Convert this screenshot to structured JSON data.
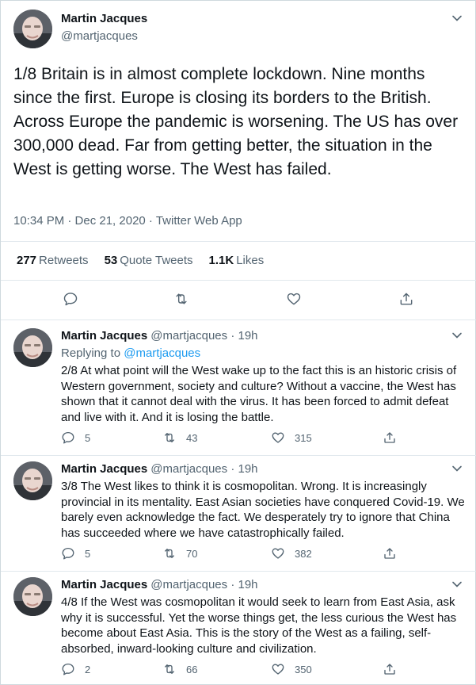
{
  "main": {
    "name": "Martin Jacques",
    "handle": "@martjacques",
    "text": "1/8 Britain is in almost complete lockdown. Nine months since the first. Europe is closing its borders to the British. Across Europe the pandemic is worsening. The US has over 300,000 dead. Far from getting better, the situation in the West is getting worse. The West has failed.",
    "meta": "10:34 PM · Dec 21, 2020 · Twitter Web App",
    "stats": {
      "retweets_count": "277",
      "retweets_label": "Retweets",
      "quotes_count": "53",
      "quotes_label": "Quote Tweets",
      "likes_count": "1.1K",
      "likes_label": "Likes"
    }
  },
  "replies": [
    {
      "name": "Martin Jacques",
      "handle": "@martjacques · 19h",
      "replying_prefix": "Replying to",
      "replying_to": "@martjacques",
      "text": "2/8 At what point will the West wake up to the fact this is an historic crisis of Western government, society and culture? Without a vaccine, the West has shown that it cannot deal with the virus. It has been forced to admit defeat and live with it. And it is losing the battle.",
      "replies": "5",
      "retweets": "43",
      "likes": "315"
    },
    {
      "name": "Martin Jacques",
      "handle": "@martjacques · 19h",
      "text": "3/8 The West likes to think it is cosmopolitan. Wrong. It is increasingly provincial in its mentality. East Asian societies have conquered Covid-19. We barely even acknowledge the fact. We desperately try to ignore that China has succeeded where we have catastrophically failed.",
      "replies": "5",
      "retweets": "70",
      "likes": "382"
    },
    {
      "name": "Martin Jacques",
      "handle": "@martjacques · 19h",
      "text": "4/8 If the West was cosmopolitan it would seek to learn from East Asia, ask why it is successful. Yet the worse things get, the less curious the West has become about East Asia. This is the story of the West as a failing, self-absorbed, inward-looking culture and civilization.",
      "replies": "2",
      "retweets": "66",
      "likes": "350"
    }
  ],
  "colors": {
    "link": "#1d9bf0",
    "secondary_text": "#536471",
    "divider": "#e1e8ed"
  }
}
